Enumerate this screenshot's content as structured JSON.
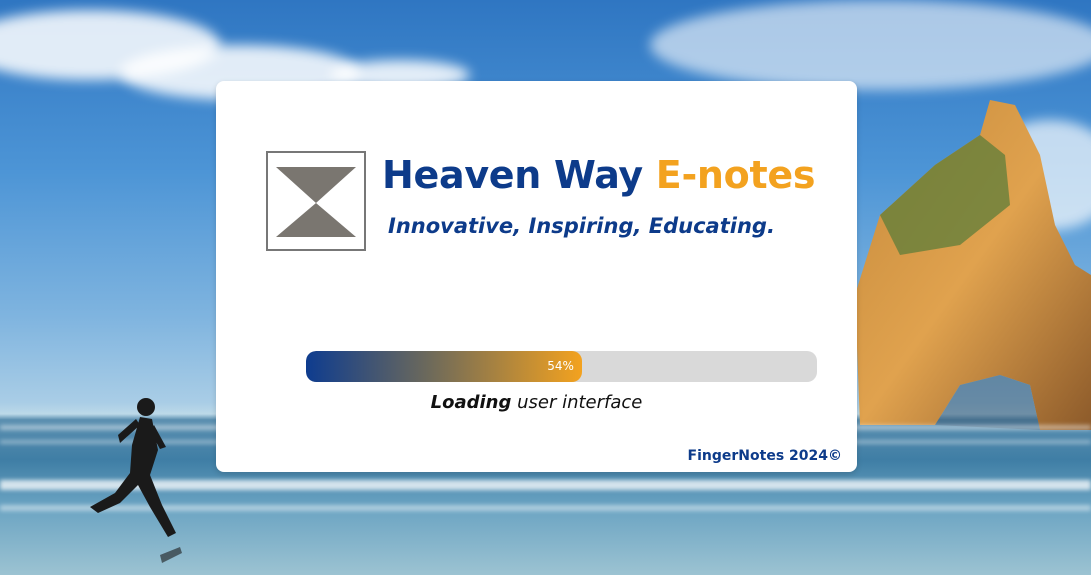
{
  "splash": {
    "title_part1": "Heaven Way",
    "title_part2": "E-notes",
    "tagline": "Innovative, Inspiring, Educating.",
    "progress": {
      "percent": 54,
      "label": "54%"
    },
    "status_bold": "Loading",
    "status_rest": " user interface",
    "copyright": "FingerNotes 2024©"
  },
  "colors": {
    "brand_blue": "#0d3b8a",
    "brand_orange": "#f3a21f",
    "logo_gray": "#7a7670",
    "track_gray": "#d9d9d9"
  },
  "icons": {
    "logo": "hourglass-logo-icon"
  }
}
